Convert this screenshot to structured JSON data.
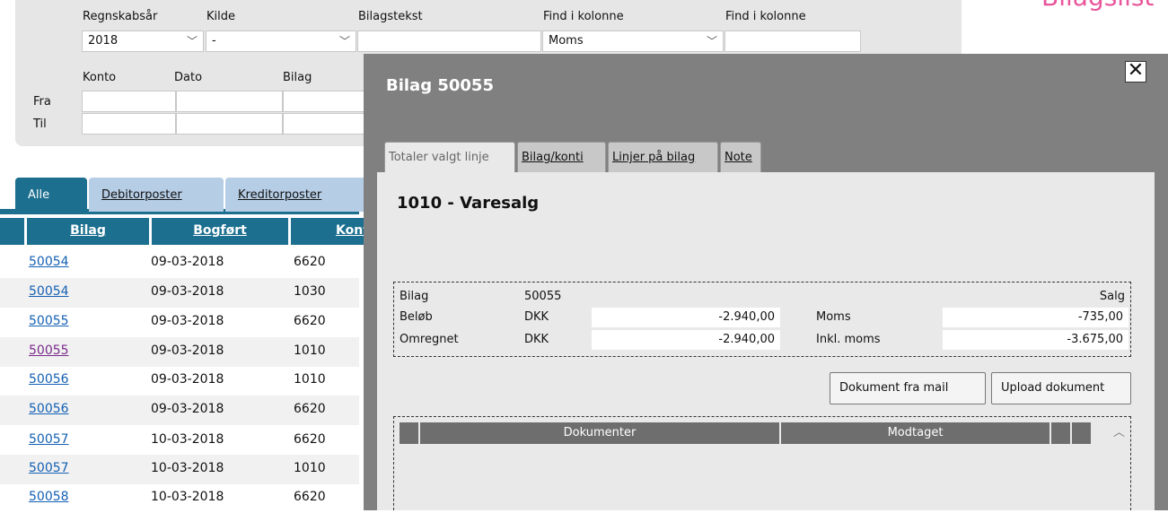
{
  "page": {
    "title_fragment": "Bilagslist"
  },
  "filters": {
    "regnskabsaar": {
      "label": "Regnskabsår",
      "value": "2018"
    },
    "kilde": {
      "label": "Kilde",
      "value": "-"
    },
    "bilagstekst": {
      "label": "Bilagstekst",
      "value": ""
    },
    "find1": {
      "label": "Find i kolonne",
      "value": "Moms"
    },
    "find2": {
      "label": "Find i kolonne",
      "value": ""
    },
    "row_labels": {
      "from": "Fra",
      "to": "Til"
    },
    "col_labels": {
      "konto": "Konto",
      "dato": "Dato",
      "bilag": "Bilag"
    }
  },
  "main_tabs": [
    {
      "label": "Alle",
      "active": true
    },
    {
      "label": "Debitorposter",
      "active": false
    },
    {
      "label": "Kreditorposter",
      "active": false
    }
  ],
  "grid": {
    "columns": [
      "Bilag",
      "Bogført",
      "Konto"
    ],
    "rows": [
      {
        "bilag": "50054",
        "date": "09-03-2018",
        "konto": "6620",
        "visited": false
      },
      {
        "bilag": "50054",
        "date": "09-03-2018",
        "konto": "1030",
        "visited": false
      },
      {
        "bilag": "50055",
        "date": "09-03-2018",
        "konto": "6620",
        "visited": false
      },
      {
        "bilag": "50055",
        "date": "09-03-2018",
        "konto": "1010",
        "visited": true
      },
      {
        "bilag": "50056",
        "date": "09-03-2018",
        "konto": "1010",
        "visited": false
      },
      {
        "bilag": "50056",
        "date": "09-03-2018",
        "konto": "6620",
        "visited": false
      },
      {
        "bilag": "50057",
        "date": "10-03-2018",
        "konto": "6620",
        "visited": false
      },
      {
        "bilag": "50057",
        "date": "10-03-2018",
        "konto": "1010",
        "visited": false
      },
      {
        "bilag": "50058",
        "date": "10-03-2018",
        "konto": "6620",
        "visited": false
      }
    ]
  },
  "modal": {
    "title": "Bilag 50055",
    "close_glyph": "✕",
    "tabs": [
      {
        "label": "Totaler valgt linje",
        "active": true
      },
      {
        "label": "Bilag/konti",
        "active": false
      },
      {
        "label": "Linjer på bilag",
        "active": false
      },
      {
        "label": "Note",
        "active": false
      }
    ],
    "section_title": "1010 - Varesalg",
    "info": {
      "bilag_label": "Bilag",
      "bilag_value": "50055",
      "type": "Salg",
      "beloeb_label": "Beløb",
      "beloeb_currency": "DKK",
      "beloeb_value": "-2.940,00",
      "moms_label": "Moms",
      "moms_value": "-735,00",
      "omregnet_label": "Omregnet",
      "omregnet_currency": "DKK",
      "omregnet_value": "-2.940,00",
      "inkl_moms_label": "Inkl. moms",
      "inkl_moms_value": "-3.675,00"
    },
    "buttons": {
      "mail": "Dokument fra mail",
      "upload": "Upload dokument"
    },
    "documents": {
      "col_documents": "Dokumenter",
      "col_received": "Modtaget"
    }
  }
}
